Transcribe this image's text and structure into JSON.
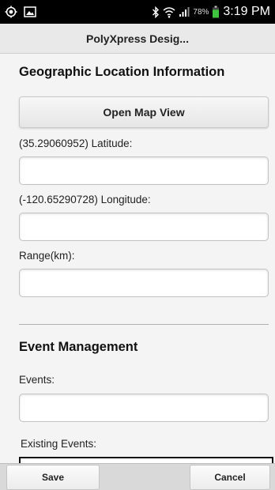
{
  "status_bar": {
    "battery_percent": "78%",
    "time": "3:19 PM",
    "icons": [
      "location-icon",
      "image-icon",
      "bluetooth-icon",
      "wifi-icon",
      "signal-icon",
      "battery-icon"
    ],
    "battery_color": "#3ec43e"
  },
  "header": {
    "title": "PolyXpress Desig..."
  },
  "geo": {
    "heading": "Geographic Location Information",
    "map_button_label": "Open Map View",
    "latitude_label": "(35.29060952) Latitude:",
    "latitude_value": "",
    "longitude_label": "(-120.65290728) Longitude:",
    "longitude_value": "",
    "range_label": "Range(km):",
    "range_value": ""
  },
  "events": {
    "heading": "Event Management",
    "events_label": "Events:",
    "events_value": "",
    "existing_label": "Existing Events:"
  },
  "footer": {
    "save_label": "Save",
    "cancel_label": "Cancel"
  }
}
